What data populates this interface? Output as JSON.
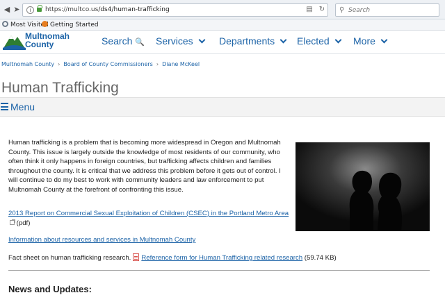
{
  "browser": {
    "url_domain": "https://multco.us",
    "url_path": "/ds4/human-trafficking",
    "search_placeholder": "Search",
    "bookmarks": [
      {
        "label": "Most Visited",
        "icon": "gear-icon"
      },
      {
        "label": "Getting Started",
        "icon": "firefox-icon"
      }
    ]
  },
  "site": {
    "logo_line1": "Multnomah",
    "logo_line2": "County",
    "nav": {
      "search": "Search",
      "services": "Services",
      "departments": "Departments",
      "elected": "Elected",
      "more": "More"
    },
    "brand_color": "#1c63a7"
  },
  "breadcrumb": [
    "Multnomah County",
    "Board of County Commissioners",
    "Diane McKeel"
  ],
  "page_title": "Human Trafficking",
  "menu_label": "Menu",
  "content": {
    "intro": "Human trafficking is a problem that is becoming more widespread in Oregon and Multnomah County. This issue is largely outside the knowledge of most residents of our community, who often think it only happens in foreign countries, but trafficking affects children and families throughout the county. It is critical that we address this problem before it gets out of control.  I will continue to do my best to work with community leaders and law enforcement to put Multnomah County at the forefront of confronting this issue.",
    "report_link": "2013 Report on Commercial Sexual Exploitation of Children (CSEC) in the Portland Metro Area",
    "report_suffix": "(pdf)",
    "resources_link": "Information about resources and services in Multnomah County",
    "fact_prefix": "Fact sheet on human trafficking research.",
    "fact_link": "Reference form for Human Trafficking related research",
    "fact_size": "(59.74 KB)",
    "news_heading": "News and Updates:"
  }
}
